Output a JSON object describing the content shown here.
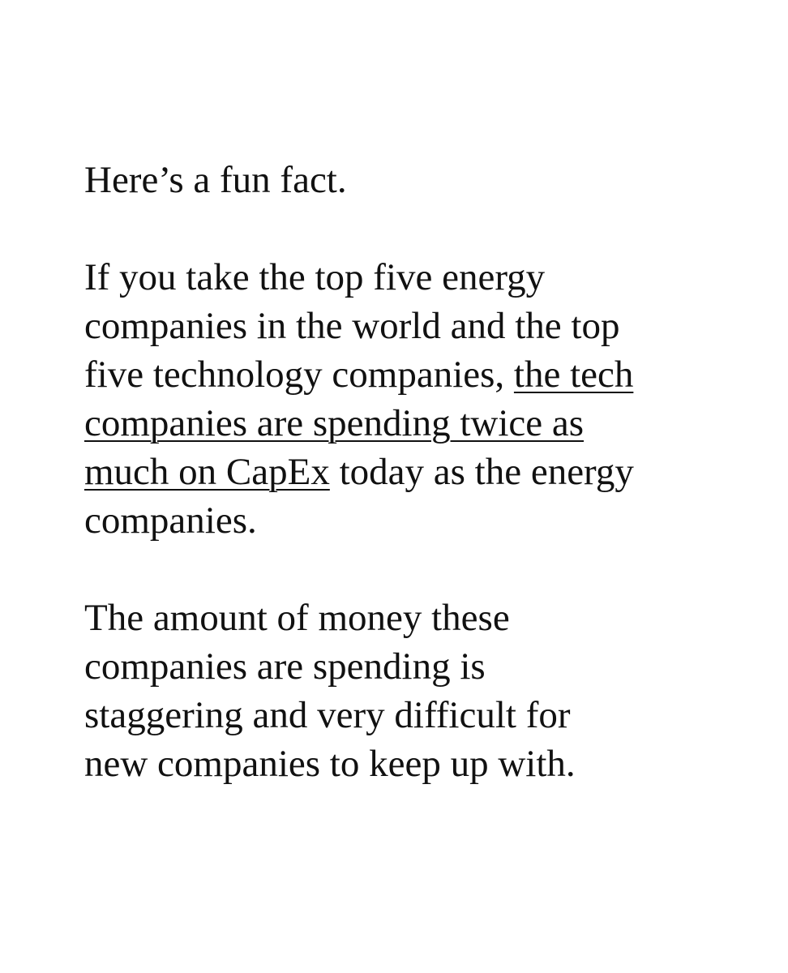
{
  "article": {
    "intro": "Here’s a fun fact.",
    "paragraph_1": {
      "line_1": "If you take the top five energy",
      "line_2": "companies in the world and the top",
      "line_3_before_link": "five technology companies, ",
      "link_line_1": "the tech",
      "link_line_2": "companies are spending twice as",
      "link_line_3": "much on CapEx",
      "line_5_after_link": " today as the energy",
      "line_6": "companies."
    },
    "paragraph_2": {
      "line_1": "The amount of money these",
      "line_2": "companies are spending is",
      "line_3": "staggering and very difficult for",
      "line_4": "new companies to keep up with."
    }
  },
  "colors": {
    "background": "#ffffff",
    "text": "#111111"
  }
}
